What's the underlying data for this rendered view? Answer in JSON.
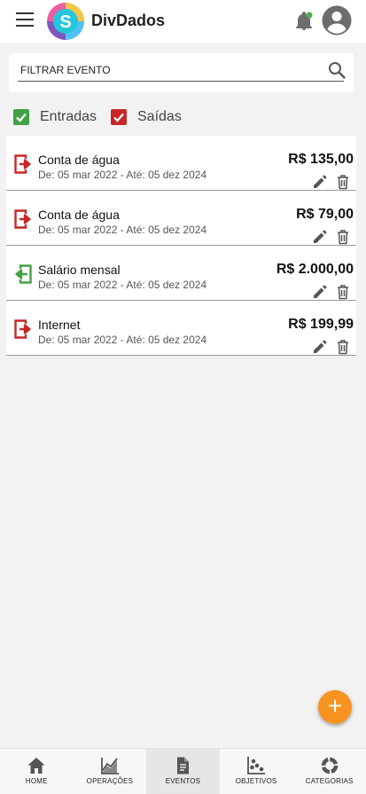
{
  "app": {
    "title": "DivDados"
  },
  "search": {
    "placeholder": "FILTRAR EVENTO"
  },
  "filters": {
    "entradas": {
      "label": "Entradas",
      "checked": true,
      "color": "#43a047"
    },
    "saidas": {
      "label": "Saídas",
      "checked": true,
      "color": "#c62828"
    }
  },
  "events": [
    {
      "name": "Conta de água",
      "dates": "De: 05 mar 2022 - Até: 05 dez 2024",
      "amount": "R$ 135,00",
      "type": "saida",
      "icon": "exit-icon"
    },
    {
      "name": "Conta de água",
      "dates": "De: 05 mar 2022 - Até: 05 dez 2024",
      "amount": "R$ 79,00",
      "type": "saida",
      "icon": "exit-icon"
    },
    {
      "name": "Salário mensal",
      "dates": "De: 05 mar 2022 - Até: 05 dez 2024",
      "amount": "R$ 2.000,00",
      "type": "entrada",
      "icon": "enter-icon"
    },
    {
      "name": "Internet",
      "dates": "De: 05 mar 2022 - Até: 05 dez 2024",
      "amount": "R$ 199,99",
      "type": "saida",
      "icon": "exit-icon"
    }
  ],
  "fab": {
    "label": "+"
  },
  "nav": [
    {
      "label": "HOME",
      "icon": "home-icon",
      "active": false
    },
    {
      "label": "OPERAÇÕES",
      "icon": "area-chart-icon",
      "active": false
    },
    {
      "label": "EVENTOS",
      "icon": "document-icon",
      "active": true
    },
    {
      "label": "OBJETIVOS",
      "icon": "scatter-chart-icon",
      "active": false
    },
    {
      "label": "CATEGORIAS",
      "icon": "donut-chart-icon",
      "active": false
    }
  ],
  "colors": {
    "accent": "#f7931e",
    "income": "#43a047",
    "expense": "#c62828",
    "notification": "#4caf50"
  }
}
